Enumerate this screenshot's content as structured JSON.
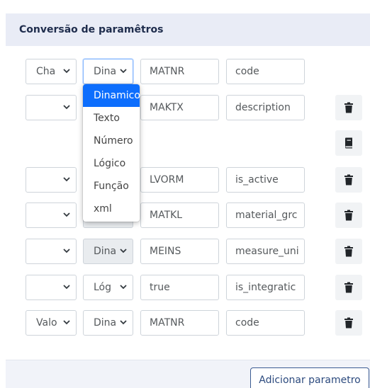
{
  "panel": {
    "title": "Conversão de paramêtros"
  },
  "rows": [
    {
      "type": "Cha",
      "kind": "Dina",
      "source": "MATNR",
      "target": "code",
      "has_delete": false
    },
    {
      "type": "",
      "kind": "",
      "source": "MAKTX",
      "target": "description",
      "has_delete": true
    },
    {
      "type": "",
      "kind": "",
      "source": "LVORM",
      "target": "is_active",
      "has_delete": true
    },
    {
      "type": "",
      "kind": "",
      "source": "MATKL",
      "target": "material_grc",
      "has_delete": true
    },
    {
      "type": "",
      "kind": "Dina",
      "source": "MEINS",
      "target": "measure_uni",
      "has_delete": true
    },
    {
      "type": "",
      "kind": "Lóg",
      "source": "true",
      "target": "is_integratic",
      "has_delete": true
    },
    {
      "type": "Valo",
      "kind": "Dina",
      "source": "MATNR",
      "target": "code",
      "has_delete": true
    }
  ],
  "dropdown": {
    "options": [
      "Dinamico",
      "Texto",
      "Número",
      "Lógico",
      "Função",
      "xml"
    ],
    "selected": "Dinamico"
  },
  "footer": {
    "add_button_label": "Adicionar parametro"
  },
  "icons": {
    "delete": "trash-icon",
    "book": "book-icon",
    "chevron": "chevron-down-icon"
  }
}
